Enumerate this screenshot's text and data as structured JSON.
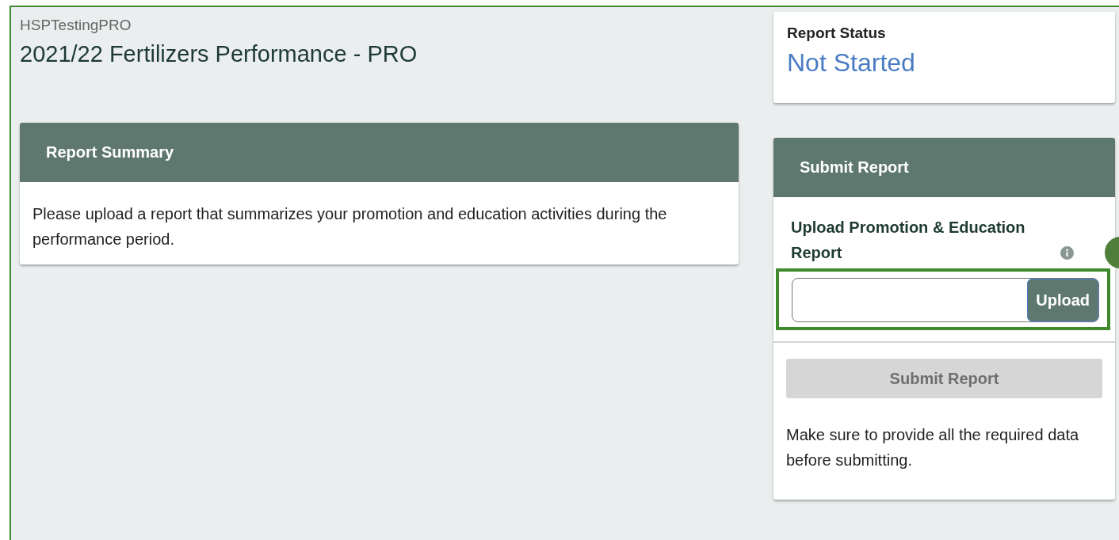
{
  "header": {
    "organization": "HSPTestingPRO",
    "title": "2021/22 Fertilizers Performance - PRO"
  },
  "report_summary": {
    "title": "Report Summary",
    "text": "Please upload a report that summarizes your promotion and education activities during the performance period."
  },
  "report_status": {
    "label": "Report Status",
    "value": "Not Started"
  },
  "submit_report": {
    "title": "Submit Report",
    "upload_label": "Upload Promotion & Education Report",
    "upload_button": "Upload",
    "highlighted": true,
    "submit_button": {
      "label": "Submit Report",
      "disabled": true
    },
    "note": "Make sure to provide all the required data before submitting."
  }
}
